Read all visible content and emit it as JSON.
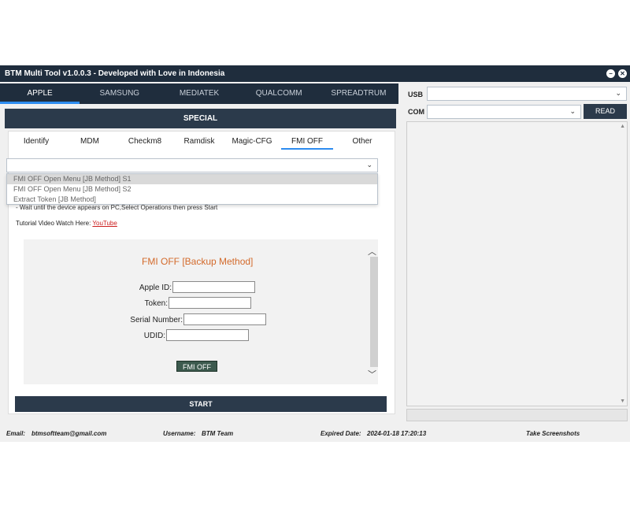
{
  "window": {
    "title": "BTM Multi Tool v1.0.0.3 - Developed with Love in Indonesia",
    "minimize_glyph": "−",
    "close_glyph": "✕"
  },
  "platform_tabs": [
    "APPLE",
    "SAMSUNG",
    "MEDIATEK",
    "QUALCOMM",
    "SPREADTRUM"
  ],
  "active_platform": "APPLE",
  "special_label": "SPECIAL",
  "sub_tabs": [
    "Identify",
    "MDM",
    "Checkm8",
    "Ramdisk",
    "Magic-CFG",
    "FMI OFF",
    "Other"
  ],
  "active_sub_tab": "FMI OFF",
  "method_select": {
    "value": "",
    "options": [
      "FMI OFF Open Menu [JB Method] S1",
      "FMI OFF Open Menu [JB Method] S2",
      "Extract Token [JB Method]"
    ],
    "highlighted": 0
  },
  "hint_text": "- Wait until the device appears on PC,Select Operations then press Start",
  "tutorial": {
    "prefix": "Tutorial Video Watch Here:",
    "link": "YouTube"
  },
  "form": {
    "title": "FMI OFF [Backup Method]",
    "apple_id_label": "Apple ID:",
    "token_label": "Token:",
    "serial_label": "Serial Number:",
    "udid_label": "UDID:",
    "apple_id_value": "",
    "token_value": "",
    "serial_value": "",
    "udid_value": "",
    "button": "FMI OFF"
  },
  "start_label": "START",
  "connection": {
    "usb_label": "USB",
    "com_label": "COM",
    "usb_value": "",
    "com_value": "",
    "read_label": "READ"
  },
  "status_bar": {
    "email_label": "Email:",
    "email": "btmsoftteam@gmail.com",
    "username_label": "Username:",
    "username": "BTM Team",
    "expired_label": "Expired Date:",
    "expired": "2024-01-18 17:20:13",
    "screenshot_label": "Take Screenshots"
  },
  "icons": {
    "chevron": "chevron-down-icon",
    "scroll_up": "scroll-up-icon",
    "scroll_down": "scroll-down-icon"
  },
  "colors": {
    "titlebar": "#1f2d3d",
    "accent": "#2d8cf0",
    "form_title": "#d36a2b",
    "link": "#cc1f1f"
  }
}
